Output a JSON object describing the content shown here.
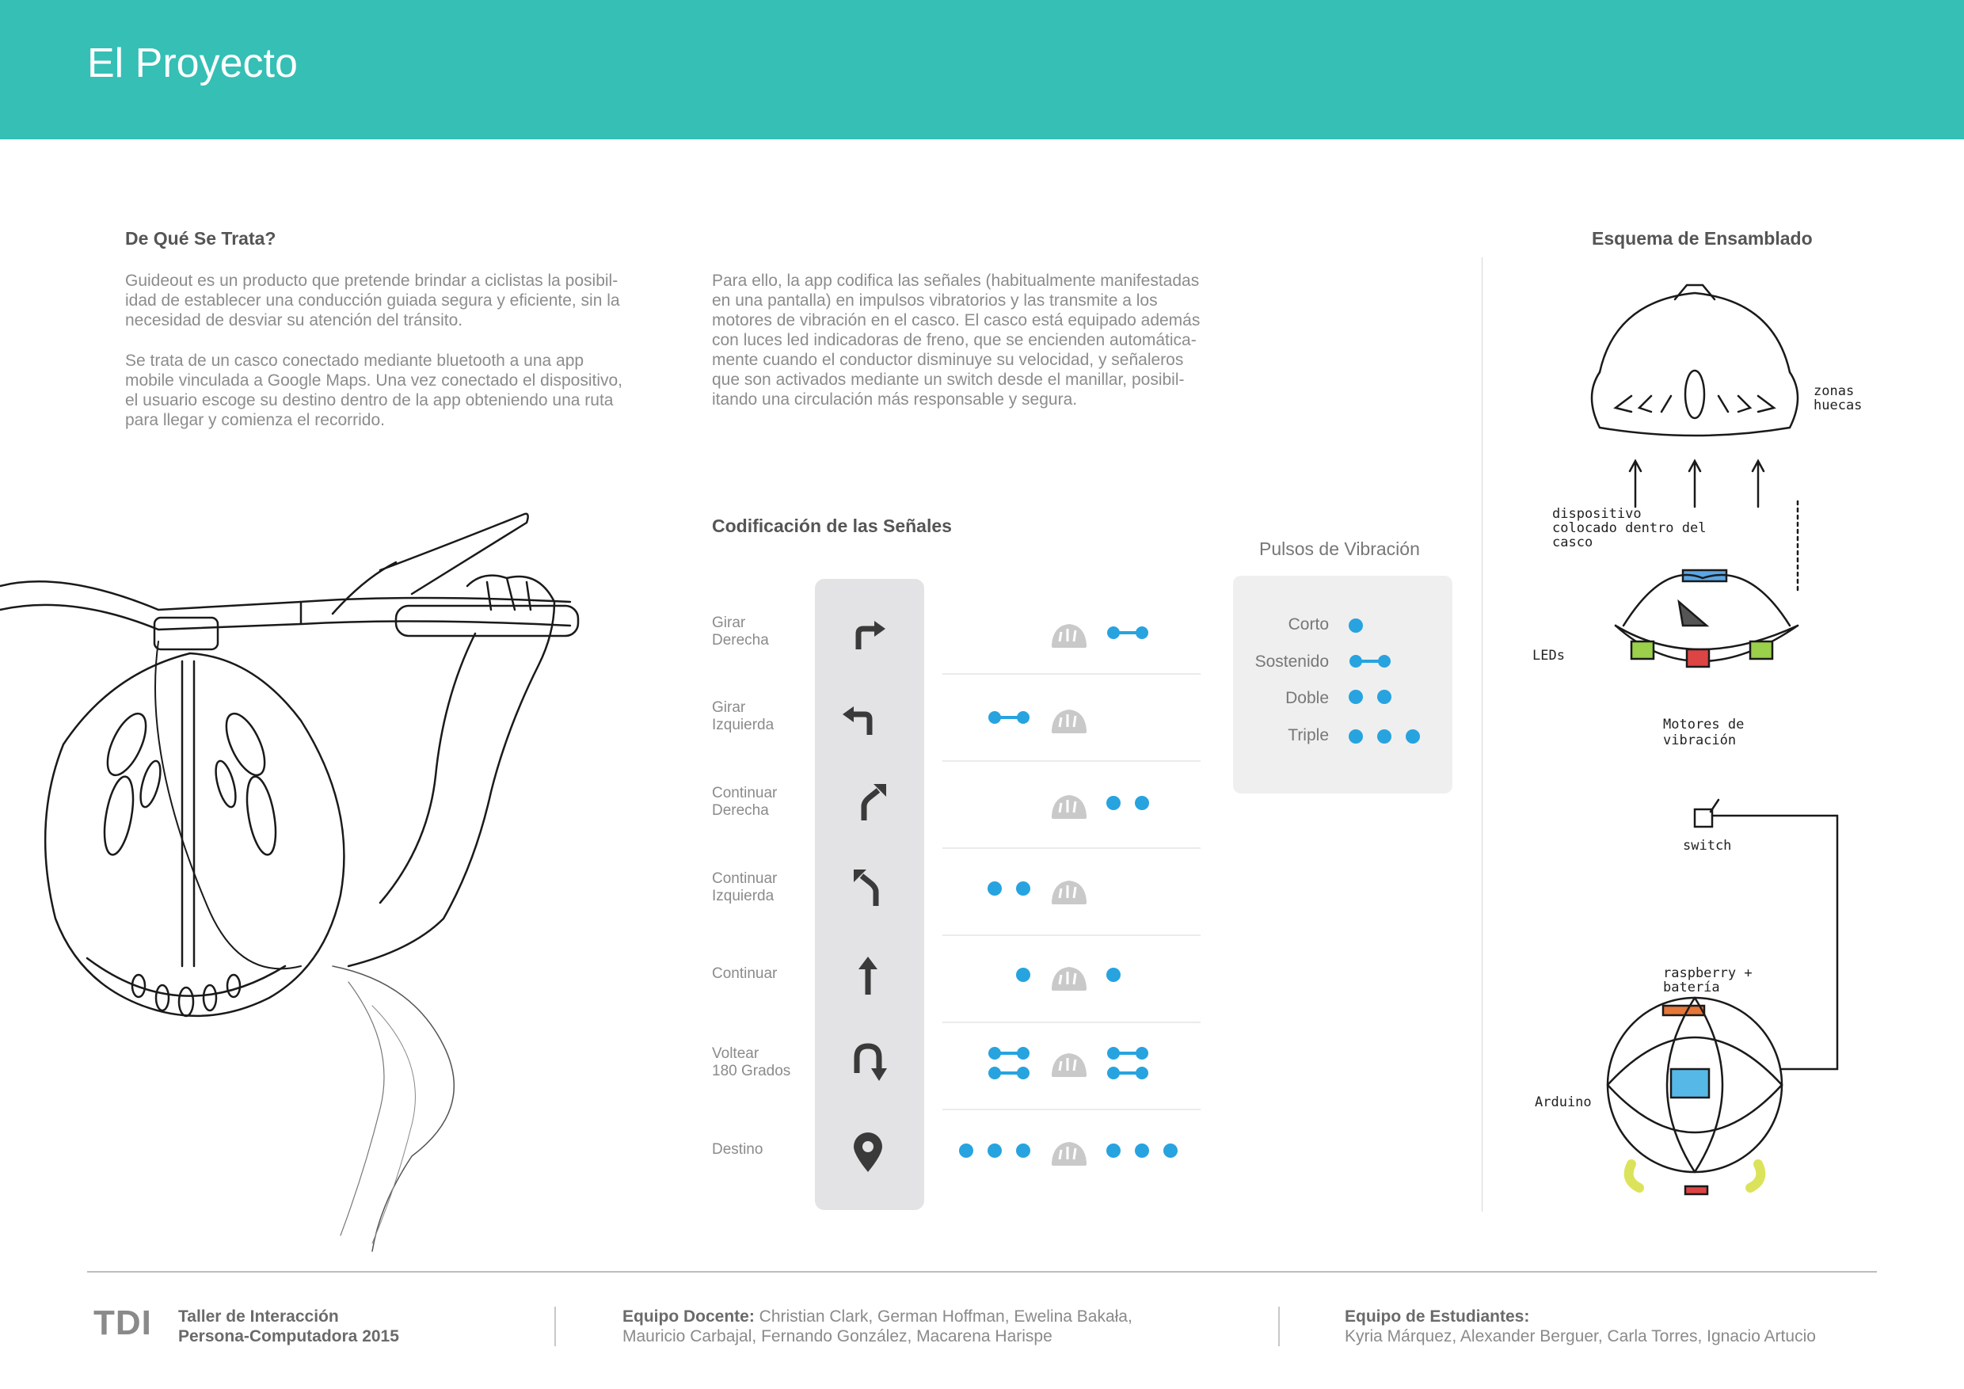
{
  "header": {
    "title": "El Proyecto"
  },
  "intro": {
    "heading": "De Qué Se Trata?",
    "p1": "Guideout es un producto que pretende brindar a ciclistas la posibil-\nidad de establecer una conducción guiada segura y eficiente, sin la\nnecesidad de desviar su atención del tránsito.",
    "p2": "Se trata de un casco conectado mediante bluetooth a una app\nmobile vinculada a Google Maps. Una vez conectado el dispositivo,\nel usuario escoge su destino dentro de la app obteniendo una ruta\npara llegar y comienza el recorrido.",
    "p3": "Para ello, la app codifica las señales (habitualmente manifestadas\nen una pantalla) en impulsos vibratorios y las transmite a los\nmotores de vibración en el casco. El casco está equipado además\ncon luces led indicadoras de freno, que se encienden automática-\nmente cuando el conductor disminuye su velocidad, y señaleros\nque son activados mediante un switch desde el manillar, posibil-\nitando una circulación más responsable y segura."
  },
  "signals": {
    "heading": "Codificación de las Señales",
    "rows": [
      {
        "label": "Girar\nDerecha",
        "icon": "turn-right-icon"
      },
      {
        "label": "Girar\nIzquierda",
        "icon": "turn-left-icon"
      },
      {
        "label": "Continuar\nDerecha",
        "icon": "bear-right-icon"
      },
      {
        "label": "Continuar\nIzquierda",
        "icon": "bear-left-icon"
      },
      {
        "label": "Continuar",
        "icon": "straight-icon"
      },
      {
        "label": "Voltear\n180 Grados",
        "icon": "u-turn-icon"
      },
      {
        "label": "Destino",
        "icon": "location-pin-icon"
      }
    ]
  },
  "pulses": {
    "heading": "Pulsos de Vibración",
    "items": [
      "Corto",
      "Sostenido",
      "Doble",
      "Triple"
    ]
  },
  "assembly": {
    "heading": "Esquema de Ensamblado",
    "labels": {
      "zonas": "zonas\nhuecas",
      "dispositivo": "dispositivo\ncolocado dentro del\ncasco",
      "leds": "LEDs",
      "motores": "Motores de\nvibración",
      "switch": "switch",
      "raspberry": "raspberry +\nbatería",
      "arduino": "Arduino"
    }
  },
  "footer": {
    "logo": "TDI",
    "course": "Taller de Interacción\nPersona-Computadora 2015",
    "teachers_label": "Equipo Docente:",
    "teachers_1": " Christian Clark, German Hoffman, Ewelina Bakała,",
    "teachers_2": "Mauricio Carbajal, Fernando González, Macarena Harispe",
    "students_label": "Equipo de Estudiantes:",
    "students": "Kyria Márquez, Alexander Berguer, Carla Torres, Ignacio Artucio"
  },
  "colors": {
    "header": "#35bfb5",
    "dot": "#27a3e0",
    "panel": "#e3e3e5"
  }
}
